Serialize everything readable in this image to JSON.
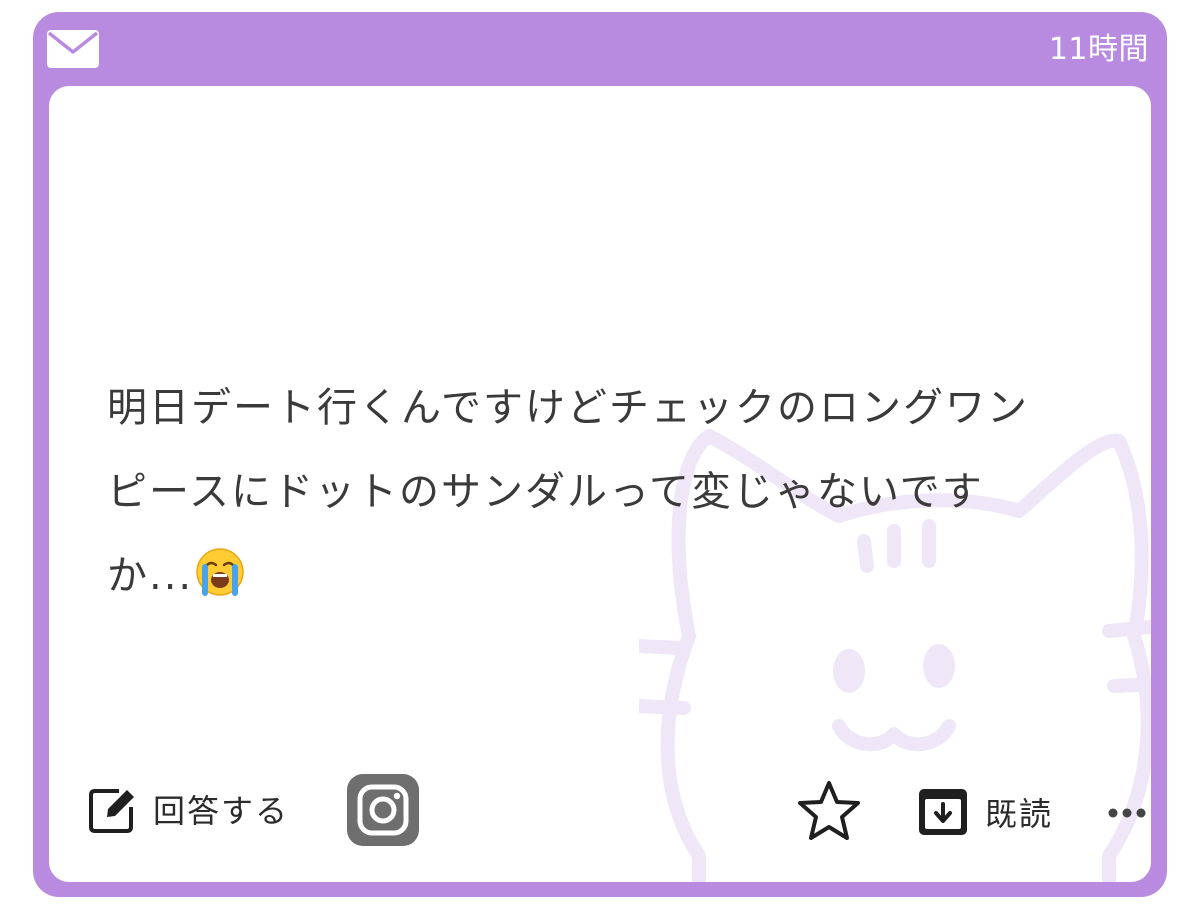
{
  "header": {
    "icon": "mail-icon",
    "time_label": "11時間"
  },
  "message": {
    "line1": "明日デート行くんですけどチェックのロングワン",
    "line2": "ピースにドットのサンダルって変じゃないです",
    "line3": "か...",
    "emoji": "loudly-crying-face-emoji"
  },
  "background_decoration": "cat-icon",
  "toolbar": {
    "answer_icon": "edit-icon",
    "answer_label": "回答する",
    "instagram_icon": "instagram-icon",
    "favorite_icon": "star-icon",
    "read_icon": "archive-icon",
    "read_label": "既読",
    "more_icon": "more-icon"
  },
  "colors": {
    "card_border": "#b88be0",
    "text": "#3a3a3a",
    "cat_outline": "#efe6f8",
    "instagram_bg": "#6e6e6e"
  }
}
